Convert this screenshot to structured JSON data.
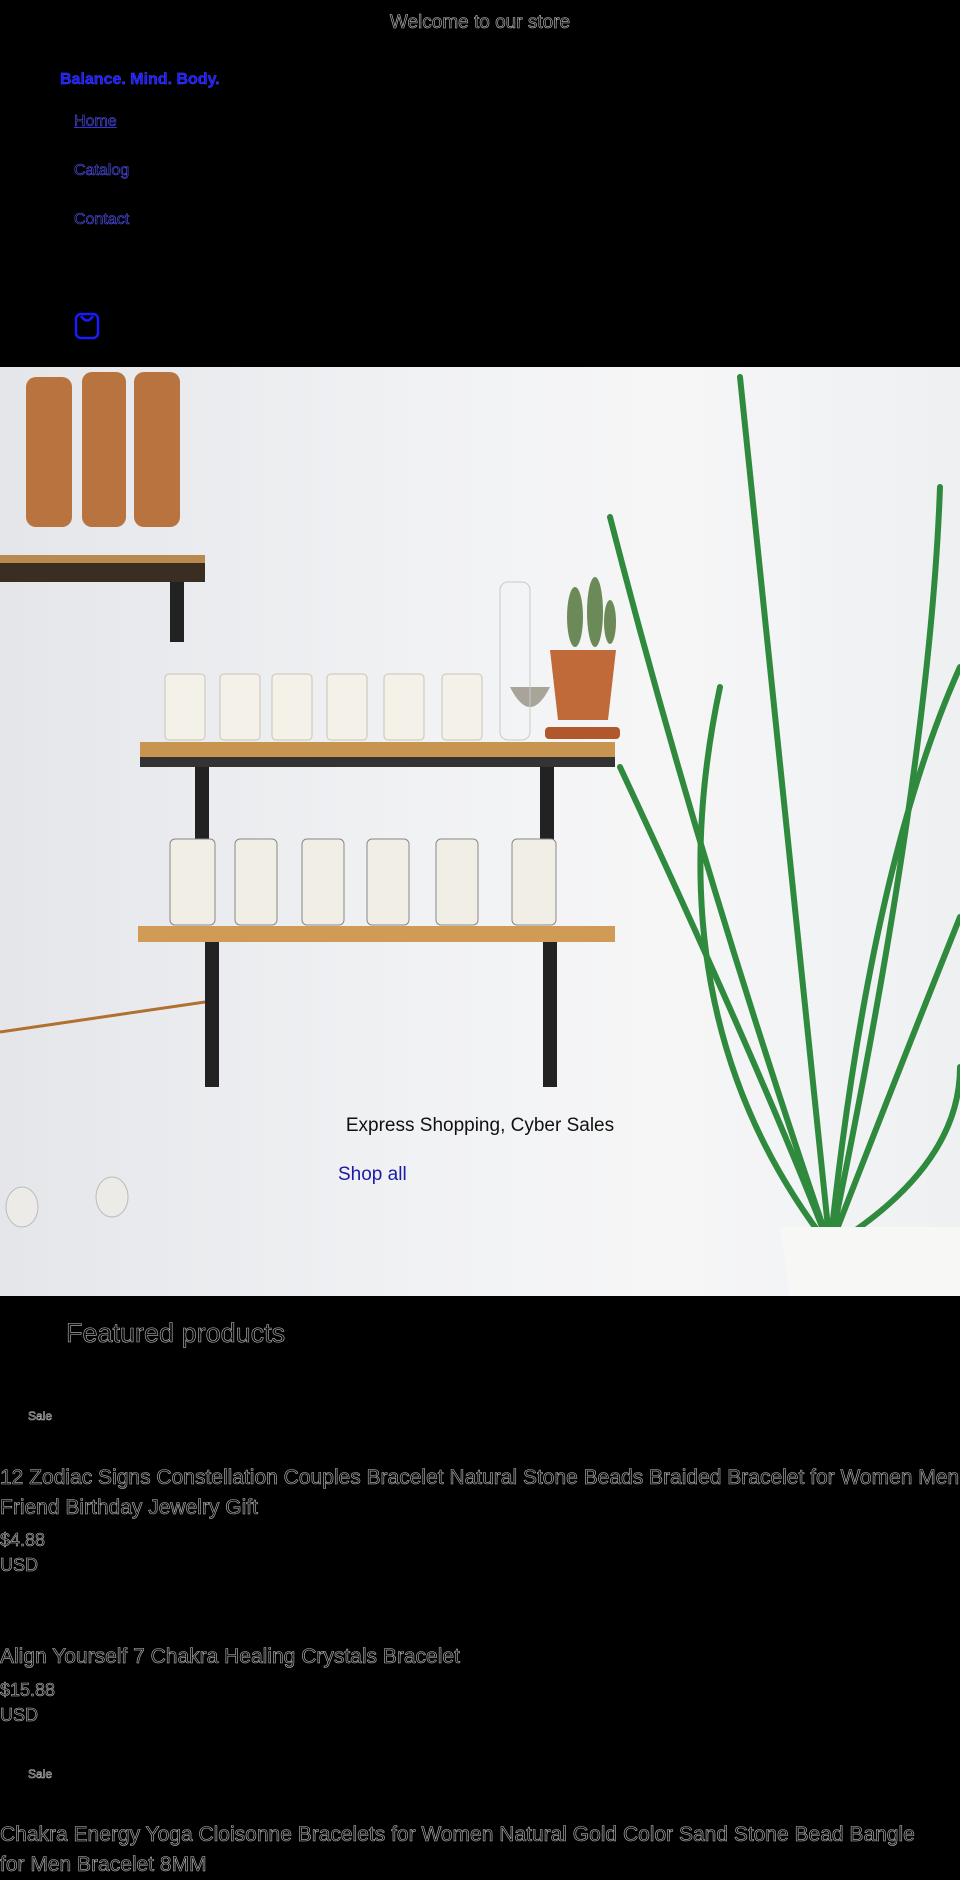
{
  "announcement": "Welcome to our store",
  "header": {
    "logo": "Balance. Mind. Body.",
    "nav": [
      {
        "label": "Home"
      },
      {
        "label": "Catalog"
      },
      {
        "label": "Contact"
      }
    ],
    "cart_icon": "bag-icon"
  },
  "hero": {
    "heading": "Express Shopping, Cyber Sales",
    "cta": "Shop all"
  },
  "featured": {
    "title": "Featured products",
    "products": [
      {
        "badge": "Sale",
        "title": "12 Zodiac Signs Constellation Couples Bracelet Natural Stone Beads Braided Bracelet for Women Men Friend Birthday Jewelry Gift",
        "price": "$4.88",
        "currency": "USD"
      },
      {
        "badge": "",
        "title": "Align Yourself 7 Chakra Healing Crystals Bracelet",
        "price": "$15.88",
        "currency": "USD"
      },
      {
        "badge": "Sale",
        "title": "Chakra Energy Yoga Cloisonne Bracelets for Women Natural Gold Color Sand Stone Bead Bangle for Men Bracelet 8MM",
        "price": "",
        "currency": ""
      }
    ]
  },
  "colors": {
    "background": "#000000",
    "link": "#1a1aff"
  }
}
